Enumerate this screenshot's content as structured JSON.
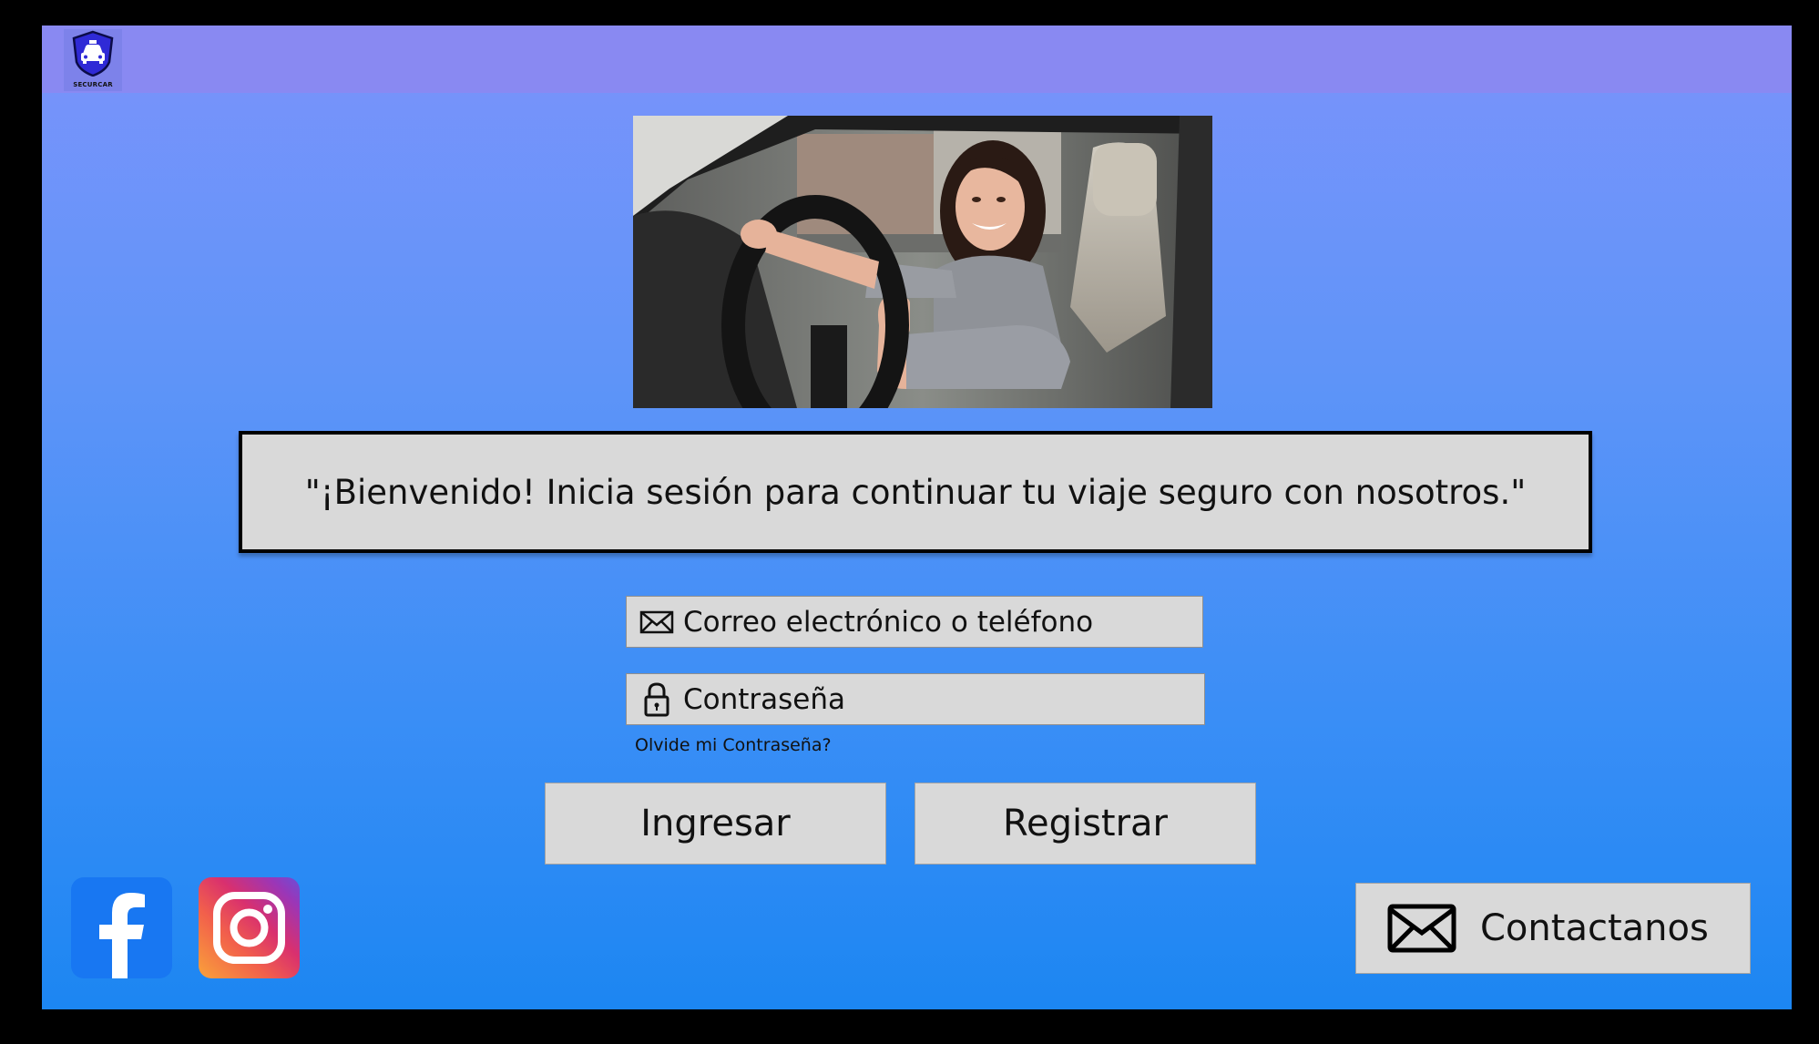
{
  "brand": {
    "name": "SECURCAR"
  },
  "welcome": {
    "text": "\"¡Bienvenido! Inicia sesión para continuar tu viaje seguro con nosotros.\""
  },
  "login": {
    "email_placeholder": "Correo electrónico o teléfono",
    "password_placeholder": "Contraseña",
    "forgot_label": "Olvide mi Contraseña?",
    "login_label": "Ingresar",
    "register_label": "Registrar"
  },
  "social": {
    "icons": [
      "facebook-icon",
      "instagram-icon"
    ]
  },
  "contact": {
    "label": "Contactanos",
    "icon": "mail-icon"
  },
  "colors": {
    "topbar": "#8989f2",
    "background_top": "#7b93fb",
    "background_bottom": "#1c86f2",
    "panel": "#d9d9d9",
    "facebook": "#1877f2"
  }
}
